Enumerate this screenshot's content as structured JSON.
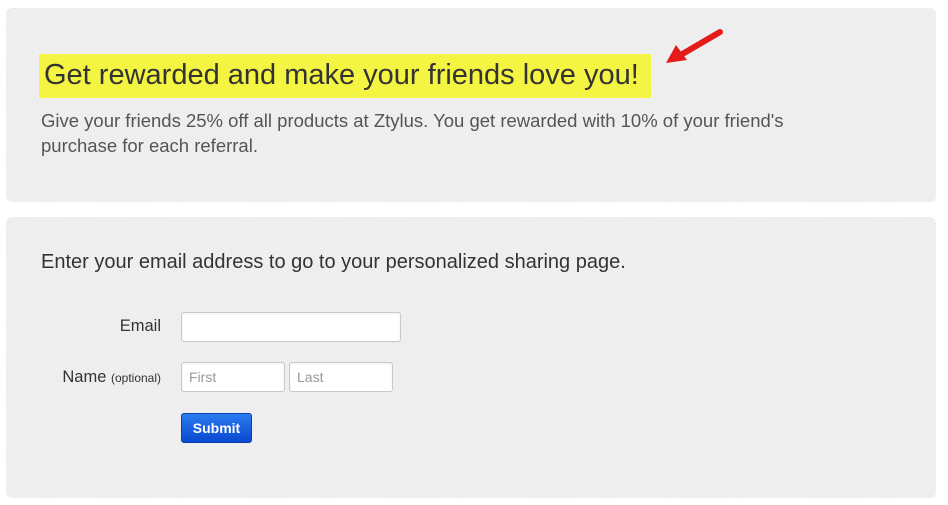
{
  "hero": {
    "headline": "Get rewarded and make your friends love you!",
    "subtext": "Give your friends 25% off all products at Ztylus. You get rewarded with 10% of your friend's purchase for each referral.",
    "highlight_color": "#f4f442",
    "arrow_color": "#e31b1b"
  },
  "signup": {
    "instruction": "Enter your email address to go to your personalized sharing page.",
    "email": {
      "label": "Email",
      "value": "",
      "placeholder": ""
    },
    "name": {
      "label": "Name",
      "optional_label": "(optional)",
      "first_placeholder": "First",
      "last_placeholder": "Last"
    },
    "submit_label": "Submit",
    "submit_color": "#0a48d0"
  }
}
